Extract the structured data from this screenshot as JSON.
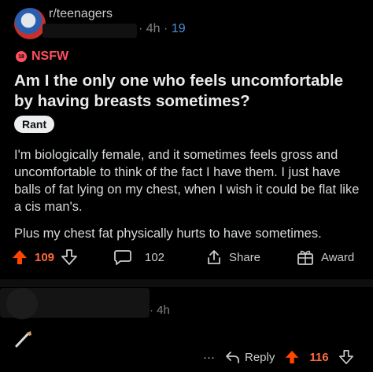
{
  "post": {
    "subreddit": "r/teenagers",
    "age": "4h",
    "separator": "·",
    "award_count": "19",
    "nsfw_label": "NSFW",
    "nsfw_icon_text": "18",
    "title": "Am I the only one who feels uncomfortable by having breasts sometimes?",
    "flair": "Rant",
    "body_paragraph_1": "I'm biologically female, and it sometimes feels gross and uncomfortable to think of the fact I have them. I just have balls of fat lying on my chest, when I wish it could be flat like a cis man's.",
    "body_paragraph_2": "Plus my chest fat physically hurts to have sometimes.",
    "upvotes": "109",
    "comments": "102",
    "share_label": "Share",
    "award_label": "Award"
  },
  "comment": {
    "age": "4h",
    "more": "···",
    "reply_label": "Reply",
    "upvotes": "116"
  },
  "colors": {
    "background": "#000000",
    "upvote": "#ff4500",
    "nsfw": "#ff4f5e",
    "award_count": "#4c8fd6"
  }
}
